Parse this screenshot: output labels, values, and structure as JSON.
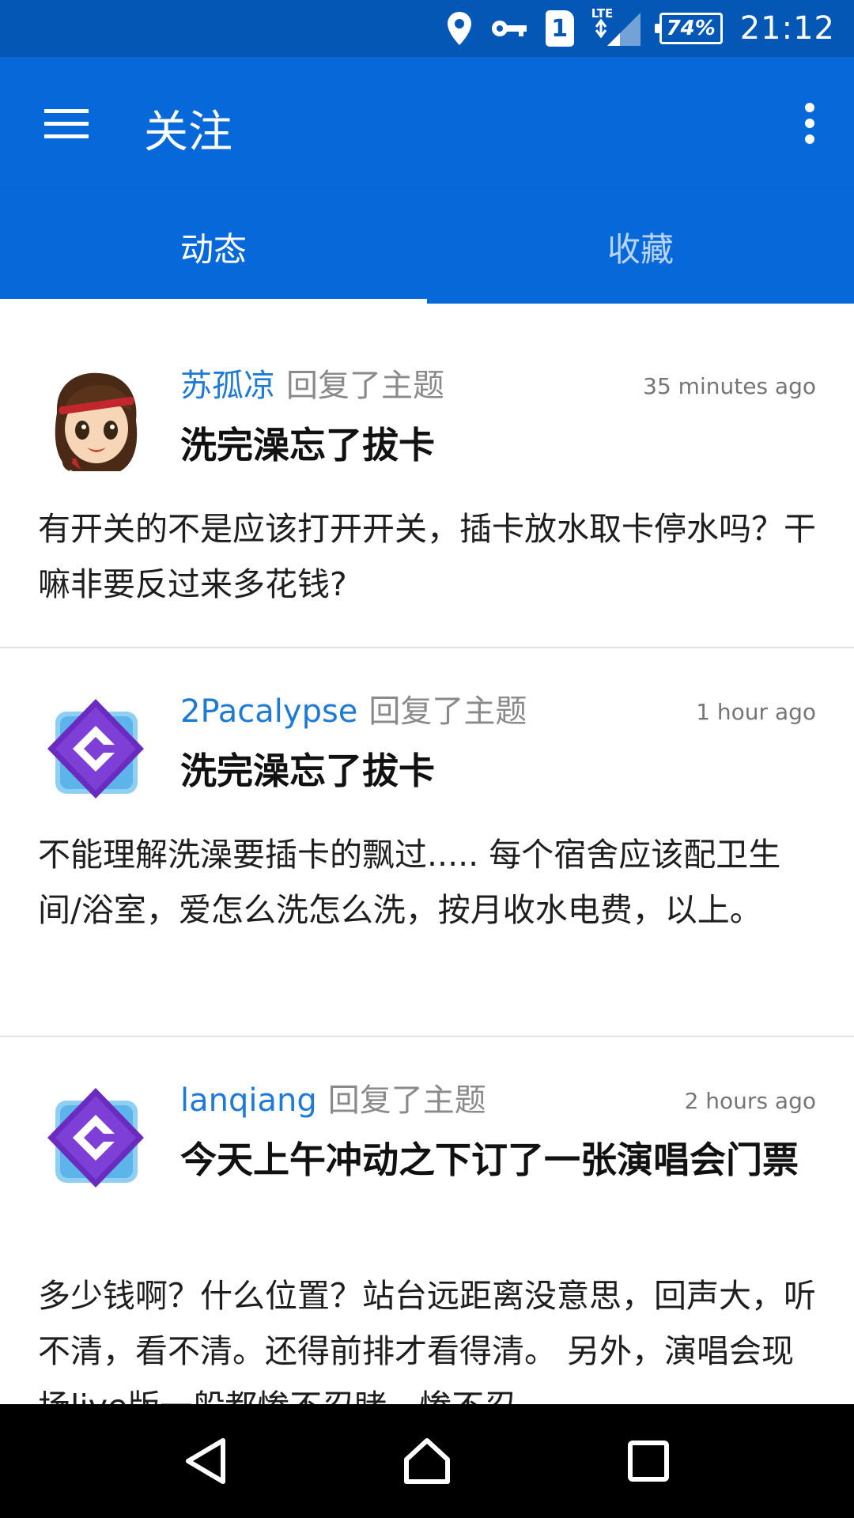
{
  "status_bar": {
    "sim_slot": "1",
    "network_type": "LTE",
    "battery_percent": "74%",
    "time": "21:12",
    "icons": [
      "location-icon",
      "vpn-key-icon",
      "sim-icon",
      "signal-icon",
      "battery-icon"
    ]
  },
  "toolbar": {
    "title": "关注",
    "menu_icon": "hamburger-menu-icon",
    "more_icon": "more-vert-icon",
    "color": "#0668d9"
  },
  "tabs": [
    {
      "label": "动态",
      "active": true
    },
    {
      "label": "收藏",
      "active": false
    }
  ],
  "feed": [
    {
      "user": "苏孤凉",
      "action": "回复了主题",
      "time": "35 minutes ago",
      "topic": "洗完澡忘了拔卡",
      "body": "有开关的不是应该打开开关，插卡放水取卡停水吗？干嘛非要反过来多花钱?",
      "avatar": "anime-girl-avatar"
    },
    {
      "user": "2Pacalypse",
      "action": "回复了主题",
      "time": "1 hour ago",
      "topic": "洗完澡忘了拔卡",
      "body": "不能理解洗澡要插卡的飘过..... 每个宿舍应该配卫生间/浴室，爱怎么洗怎么洗，按月收水电费，以上。",
      "avatar": "default-logo-avatar"
    },
    {
      "user": "lanqiang",
      "action": "回复了主题",
      "time": "2 hours ago",
      "topic": "今天上午冲动之下订了一张演唱会门票",
      "body": "多少钱啊？什么位置？站台远距离没意思，回声大，听不清，看不清。还得前排才看得清。 另外，演唱会现场live版一般都惨不忍睹，惨不忍",
      "avatar": "default-logo-avatar"
    }
  ],
  "nav_bar": {
    "back_icon": "back-icon",
    "home_icon": "home-icon",
    "recents_icon": "recents-icon"
  }
}
